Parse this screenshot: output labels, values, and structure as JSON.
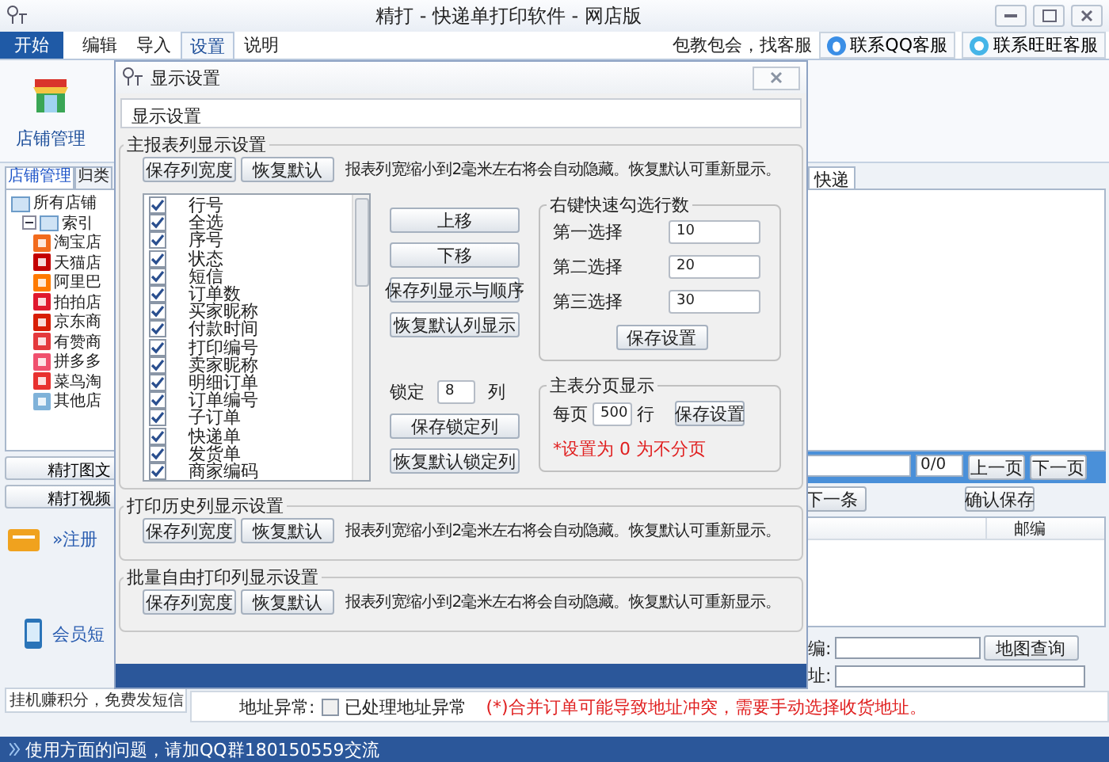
{
  "window": {
    "title": "精打 - 快递单打印软件 - 网店版"
  },
  "menu": {
    "tabs": [
      {
        "label": "开始",
        "kind": "start",
        "selected": false
      },
      {
        "label": "编辑",
        "kind": "tab",
        "selected": false
      },
      {
        "label": "导入",
        "kind": "tab",
        "selected": false
      },
      {
        "label": "设置",
        "kind": "tab",
        "selected": true
      },
      {
        "label": "说明",
        "kind": "tab",
        "selected": false
      }
    ],
    "help_text": "包教包会，找客服",
    "buttons": [
      {
        "label": "联系QQ客服",
        "kind": "qq"
      },
      {
        "label": "联系旺旺客服",
        "kind": "wangwang"
      }
    ]
  },
  "ribbon": {
    "items": [
      {
        "label": "店铺管理"
      }
    ]
  },
  "left_panel": {
    "tabs": [
      {
        "label": "店铺管理",
        "selected": true
      },
      {
        "label": "归类",
        "selected": false
      }
    ],
    "tree": {
      "label": "所有店铺",
      "children": [
        {
          "label": "索引",
          "expanded": true,
          "children": [
            {
              "label": "淘宝店",
              "color": "#f26b1d"
            },
            {
              "label": "天猫店",
              "color": "#c40000"
            },
            {
              "label": "阿里巴",
              "color": "#ff7a00"
            },
            {
              "label": "拍拍店",
              "color": "#e0182d"
            },
            {
              "label": "京东商",
              "color": "#d81e06"
            },
            {
              "label": "有赞商",
              "color": "#e4393c"
            },
            {
              "label": "拼多多",
              "color": "#f0506e"
            },
            {
              "label": "菜鸟淘",
              "color": "#e8312f"
            },
            {
              "label": "其他店",
              "color": "#7fb2d9"
            }
          ]
        }
      ]
    },
    "buttons": [
      "精打图文",
      "精打视频"
    ],
    "register_link": "»注册",
    "sms_label": "会员短",
    "sms_note": "挂机赚积分，免费发短信"
  },
  "right_panel": {
    "tab": "快递",
    "pager": {
      "value": "0/0",
      "buttons": [
        "上一页",
        "下一页"
      ]
    },
    "buttons": [
      "下一条",
      "确认保存"
    ],
    "table": {
      "columns": [
        "邮编"
      ]
    },
    "form": [
      {
        "label": "编:",
        "button": "地图查询"
      },
      {
        "label": "址:"
      }
    ]
  },
  "address_bar": {
    "label": "地址异常:",
    "checkbox": {
      "label": "已处理地址异常",
      "checked": false
    },
    "warning": "(*)合并订单可能导致地址冲突，需要手动选择收货地址。"
  },
  "status_bar": "使用方面的问题，请加QQ群180150559交流",
  "dialog": {
    "title": "显示设置",
    "header": "显示设置",
    "main_group": {
      "title": "主报表列显示设置",
      "buttons": [
        "保存列宽度",
        "恢复默认"
      ],
      "note": "报表列宽缩小到2毫米左右将会自动隐藏。恢复默认可重新显示。",
      "columns": [
        {
          "label": "行号",
          "checked": true
        },
        {
          "label": "全选",
          "checked": true
        },
        {
          "label": "序号",
          "checked": true
        },
        {
          "label": "状态",
          "checked": true
        },
        {
          "label": "短信",
          "checked": true
        },
        {
          "label": "订单数",
          "checked": true
        },
        {
          "label": "买家昵称",
          "checked": true
        },
        {
          "label": "付款时间",
          "checked": true
        },
        {
          "label": "打印编号",
          "checked": true
        },
        {
          "label": "卖家昵称",
          "checked": true
        },
        {
          "label": "明细订单",
          "checked": true
        },
        {
          "label": "订单编号",
          "checked": true
        },
        {
          "label": "子订单",
          "checked": true
        },
        {
          "label": "快递单",
          "checked": true
        },
        {
          "label": "发货单",
          "checked": true
        },
        {
          "label": "商家编码",
          "checked": true
        }
      ],
      "move_buttons": [
        "上移",
        "下移",
        "保存列显示与顺序",
        "恢复默认列显示"
      ],
      "lock": {
        "label": "锁定",
        "value": "8",
        "unit": "列",
        "buttons": [
          "保存锁定列",
          "恢复默认锁定列"
        ]
      },
      "quick_select": {
        "title": "右键快速勾选行数",
        "rows": [
          {
            "label": "第一选择",
            "value": "10"
          },
          {
            "label": "第二选择",
            "value": "20"
          },
          {
            "label": "第三选择",
            "value": "30"
          }
        ],
        "button": "保存设置"
      },
      "paging": {
        "title": "主表分页显示",
        "label": "每页",
        "value": "500",
        "unit": "行",
        "button": "保存设置",
        "hint": "*设置为 0 为不分页"
      }
    },
    "groups": [
      {
        "title": "打印历史列显示设置",
        "buttons": [
          "保存列宽度",
          "恢复默认"
        ],
        "note": "报表列宽缩小到2毫米左右将会自动隐藏。恢复默认可重新显示。"
      },
      {
        "title": "批量自由打印列显示设置",
        "buttons": [
          "保存列宽度",
          "恢复默认"
        ],
        "note": "报表列宽缩小到2毫米左右将会自动隐藏。恢复默认可重新显示。"
      }
    ]
  }
}
